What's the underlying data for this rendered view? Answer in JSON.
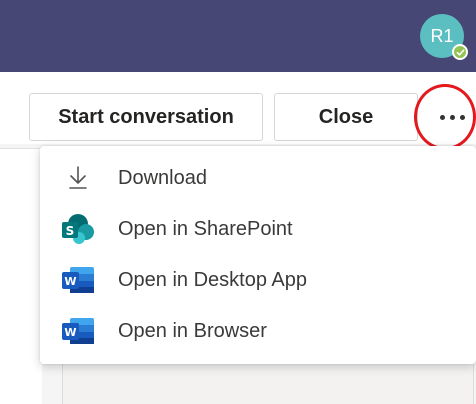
{
  "header": {
    "avatar_initials": "R1",
    "presence": "available",
    "brand_color": "#464775",
    "avatar_color": "#5bbfc2",
    "presence_color": "#92c353"
  },
  "toolbar": {
    "start_conversation_label": "Start conversation",
    "close_label": "Close",
    "more_options_icon": "ellipsis-icon",
    "annotation_color": "#e3191e"
  },
  "menu": {
    "items": [
      {
        "label": "Download",
        "icon": "download-icon"
      },
      {
        "label": "Open in SharePoint",
        "icon": "sharepoint-icon"
      },
      {
        "label": "Open in Desktop App",
        "icon": "word-icon"
      },
      {
        "label": "Open in Browser",
        "icon": "word-icon"
      }
    ]
  }
}
